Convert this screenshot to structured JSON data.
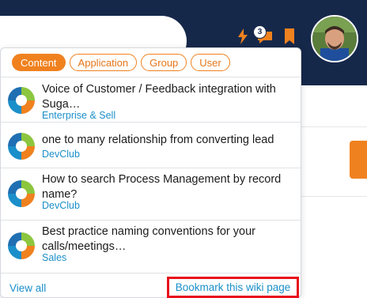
{
  "header": {
    "notification_count": "3",
    "icons": [
      "lightning-icon",
      "chat-icon",
      "bookmark-icon"
    ],
    "accent_color": "#f0811f",
    "bg_color": "#16284a"
  },
  "tabs": [
    {
      "label": "Content",
      "active": true
    },
    {
      "label": "Application",
      "active": false
    },
    {
      "label": "Group",
      "active": false
    },
    {
      "label": "User",
      "active": false
    }
  ],
  "results": [
    {
      "title": "Voice of Customer / Feedback integration with Suga…",
      "category": "Enterprise & Sell"
    },
    {
      "title": "one to many relationship from converting lead",
      "category": "DevClub"
    },
    {
      "title": "How to search Process Management by record name?",
      "category": "DevClub"
    },
    {
      "title": "Best practice naming conventions for your calls/meetings…",
      "category": "Sales"
    }
  ],
  "footer": {
    "view_all": "View all",
    "bookmark": "Bookmark this wiki page"
  }
}
